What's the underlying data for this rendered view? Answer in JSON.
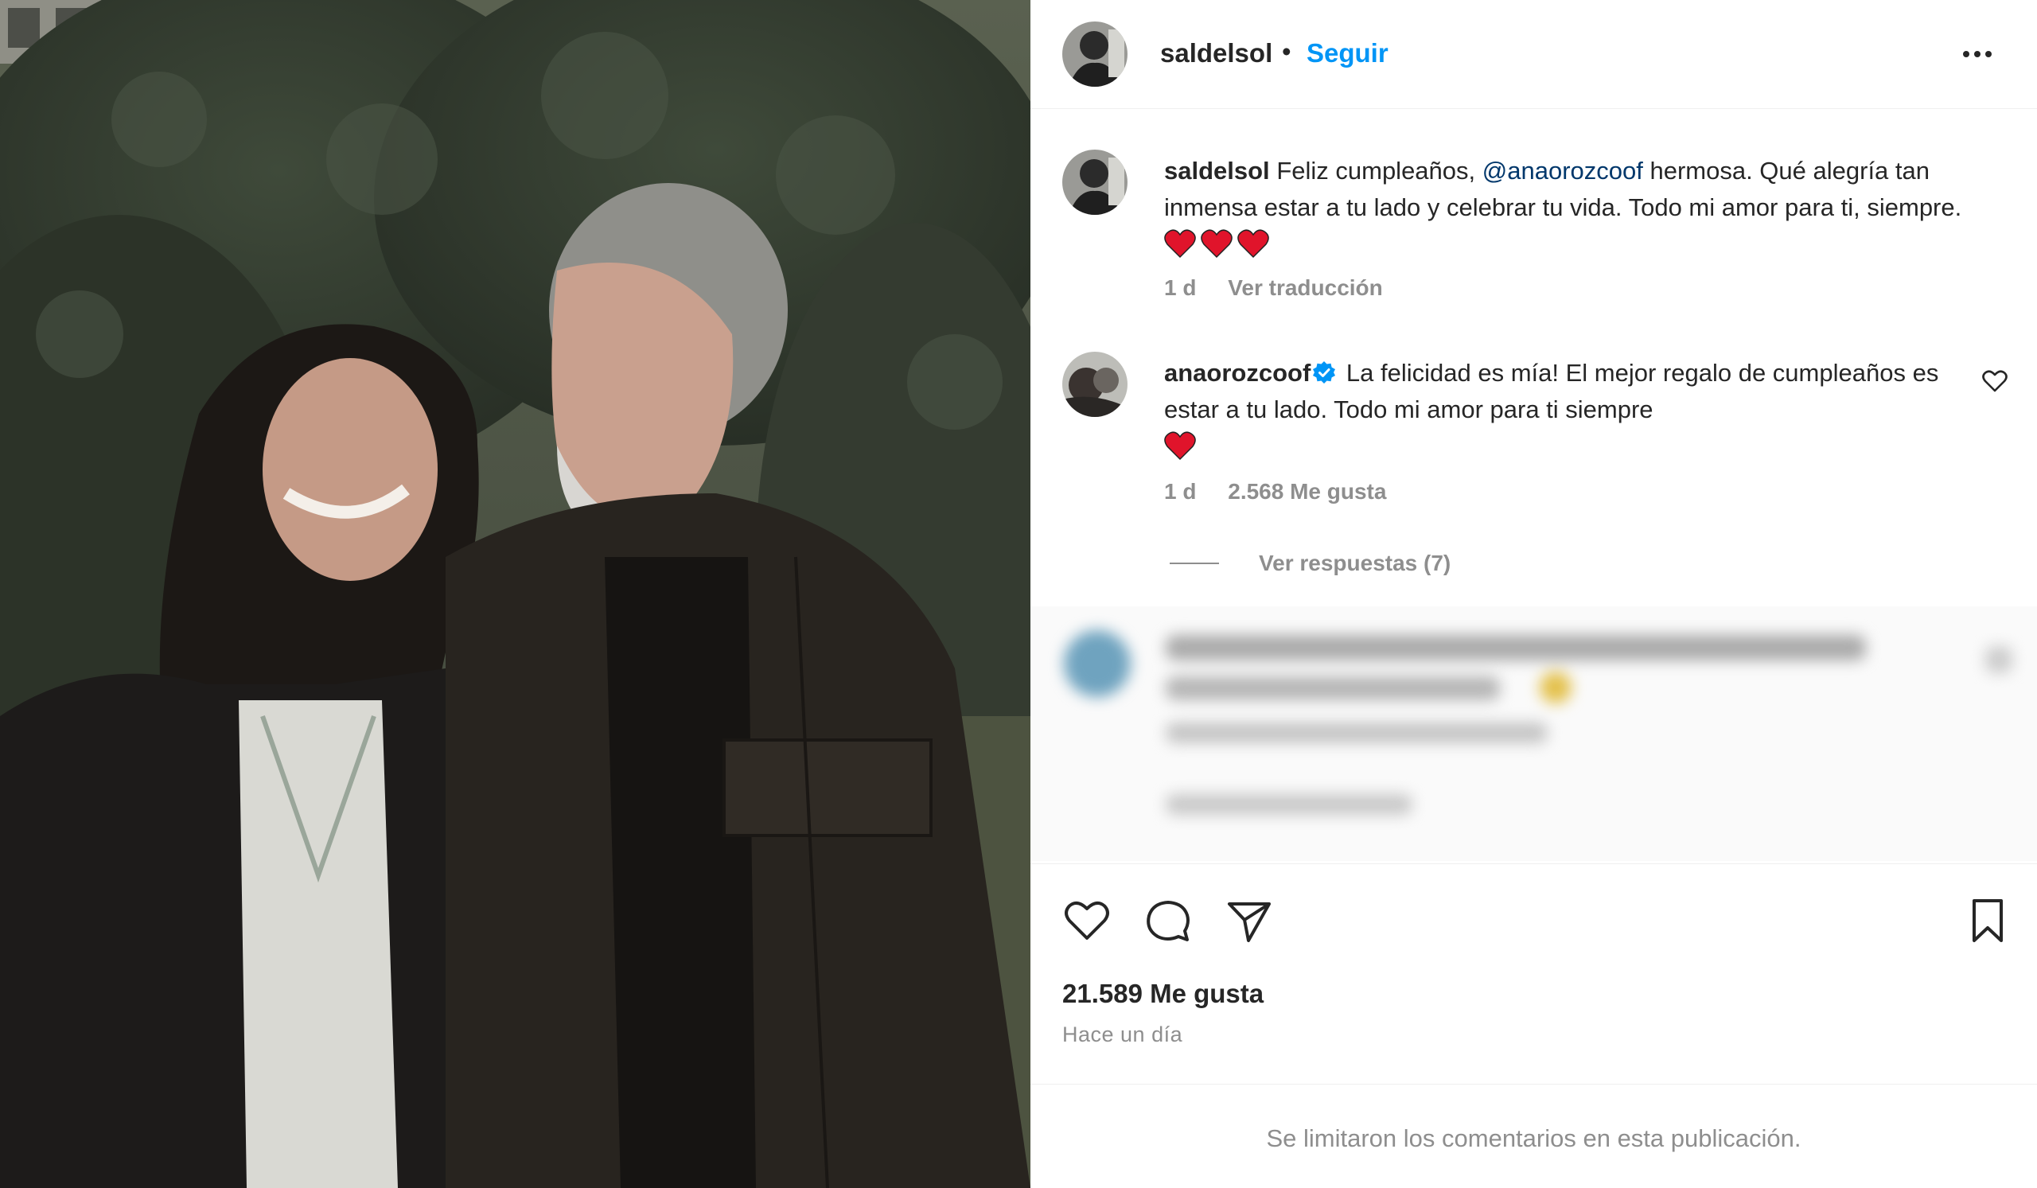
{
  "post": {
    "username": "saldelsol",
    "follow_label": "Seguir",
    "more_icon": "more-options-icon"
  },
  "caption": {
    "username": "saldelsol",
    "text_before": "Feliz cumpleaños, ",
    "mention": "@anaorozcoof",
    "text_after": " hermosa. Qué alegría tan inmensa estar a tu lado y celebrar tu vida. Todo mi amor para ti, siempre.",
    "time": "1 d",
    "translate_label": "Ver traducción"
  },
  "reply_comment": {
    "username": "anaorozcoof",
    "text": "La felicidad es mía! El mejor regalo de cumpleaños es estar a tu lado. Todo mi amor para ti siempre",
    "time": "1 d",
    "likes": "2.568 Me gusta",
    "view_replies": "Ver respuestas (7)"
  },
  "stats": {
    "likes": "21.589 Me gusta",
    "time": "Hace un día"
  },
  "footer": {
    "limited_comments": "Se limitaron los comentarios en esta publicación."
  },
  "colors": {
    "accent": "#0095f6",
    "mention": "#00376b",
    "secondary_text": "#8e8e8e",
    "heart": "#e0142b"
  }
}
